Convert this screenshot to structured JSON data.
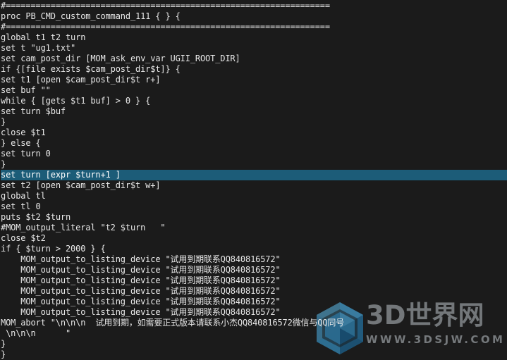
{
  "editor": {
    "name": "tcl-source-view",
    "background": "#1b1b1b",
    "foreground": "#e8e8e8",
    "selection_background": "#1c5c78",
    "selected_line_index": 16,
    "lines": [
      "#=================================================================",
      "proc PB_CMD_custom_command_111 { } {",
      "#=================================================================",
      "global t1 t2 turn",
      "set t \"ug1.txt\"",
      "set cam_post_dir [MOM_ask_env_var UGII_ROOT_DIR]",
      "if {[file exists $cam_post_dir$t]} {",
      "set t1 [open $cam_post_dir$t r+]",
      "set buf \"\"",
      "while { [gets $t1 buf] > 0 } {",
      "set turn $buf",
      "}",
      "close $t1",
      "} else {",
      "set turn 0",
      "}",
      "set turn [expr $turn+1 ]",
      "set t2 [open $cam_post_dir$t w+]",
      "global tl",
      "set tl 0",
      "puts $t2 $turn",
      "#MOM_output_literal \"t2 $turn   \"",
      "close $t2",
      "if { $turn > 2000 } {",
      "    MOM_output_to_listing_device \"试用到期联系QQ840816572\"",
      "    MOM_output_to_listing_device \"试用到期联系QQ840816572\"",
      "    MOM_output_to_listing_device \"试用到期联系QQ840816572\"",
      "    MOM_output_to_listing_device \"试用到期联系QQ840816572\"",
      "    MOM_output_to_listing_device \"试用到期联系QQ840816572\"",
      "    MOM_output_to_listing_device \"试用到期联系QQ840816572\"",
      "MOM_abort \"\\n\\n\\n  试用到期，如需要正式版本请联系小杰QQ840816572微信与QQ同号",
      " \\n\\n\\n      \"",
      "}",
      "}"
    ]
  },
  "watermark": {
    "logo_icon": "hexagon-logo-icon",
    "brand": "3D世界网",
    "url": "WWW.3DSJW.COM",
    "logo_color_dark": "#1c4f6e",
    "logo_color_mid": "#2d7196",
    "logo_color_light": "#3f6f88",
    "text_color": "#73777a"
  }
}
